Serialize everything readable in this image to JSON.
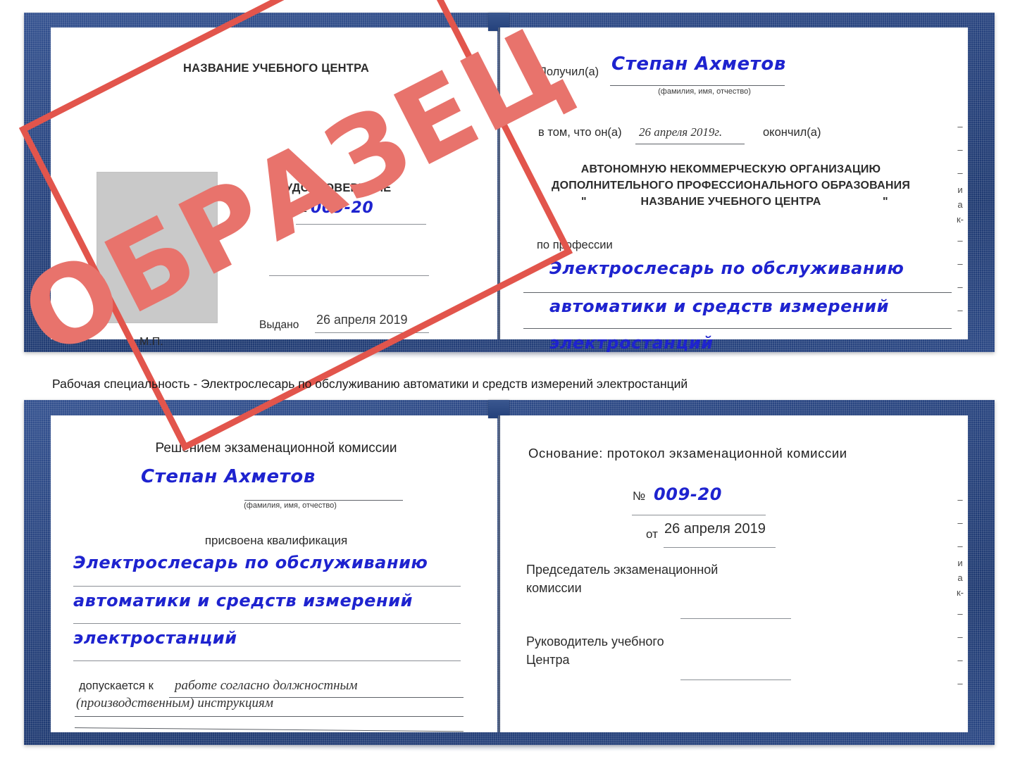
{
  "caption": {
    "text": "Рабочая специальность - Электрослесарь по обслуживанию автоматики и средств измерений электростанций"
  },
  "watermark": {
    "label": "ОБРАЗЕЦ",
    "frame_color": "#e2554c",
    "text_color": "#e8736c"
  },
  "colors": {
    "cover_blue": "#27437e",
    "handwriting_blue": "#1e23cf",
    "page_white": "#ffffff",
    "photo_gray": "#c9c9c9",
    "rule_gray": "#8b8f95"
  },
  "certificate_top": {
    "left_page": {
      "org_title": "НАЗВАНИЕ УЧЕБНОГО ЦЕНТРА",
      "doc_title": "УДОСТОВЕРЕНИЕ",
      "number_label": "№",
      "number_value": "009-20",
      "issued_label": "Выдано",
      "issued_value": "26 апреля 2019",
      "stamp_place_label": "М.П."
    },
    "right_page": {
      "received_label": "Получил(а)",
      "received_value": "Степан Ахметов",
      "fio_hint": "(фамилия, имя, отчество)",
      "in_that_label": "в том, что он(а)",
      "finish_date": "26 апреля 2019г.",
      "finished_label": "окончил(а)",
      "org_line_1": "АВТОНОМНУЮ НЕКОММЕРЧЕСКУЮ ОРГАНИЗАЦИЮ",
      "org_line_2": "ДОПОЛНИТЕЛЬНОГО ПРОФЕССИОНАЛЬНОГО ОБРАЗОВАНИЯ",
      "org_quote_open": "\"",
      "org_line_3": "НАЗВАНИЕ УЧЕБНОГО ЦЕНТРА",
      "org_quote_close": "\"",
      "profession_label": "по профессии",
      "profession_line_1": "Электрослесарь по обслуживанию",
      "profession_line_2": "автоматики и средств измерений",
      "profession_line_3": "электростанций",
      "edge_fragments": [
        "–",
        "–",
        "–",
        "и",
        "а",
        "к-",
        "–",
        "–",
        "–",
        "–"
      ]
    }
  },
  "certificate_bottom": {
    "left_page": {
      "decision_title": "Решением экзаменационной комиссии",
      "name_value": "Степан Ахметов",
      "fio_hint": "(фамилия, имя, отчество)",
      "qualification_label": "присвоена квалификация",
      "qualification_line_1": "Электрослесарь по обслуживанию",
      "qualification_line_2": "автоматики и средств измерений",
      "qualification_line_3": "электростанций",
      "admitted_label": "допускается к",
      "admitted_value_1": "работе согласно должностным",
      "admitted_value_2": "(производственным) инструкциям"
    },
    "right_page": {
      "basis_label": "Основание: протокол экзаменационной комиссии",
      "protocol_number_label": "№",
      "protocol_number_value": "009-20",
      "protocol_date_label": "от",
      "protocol_date_value": "26 апреля 2019",
      "chairman_line_1": "Председатель экзаменационной",
      "chairman_line_2": "комиссии",
      "head_line_1": "Руководитель учебного",
      "head_line_2": "Центра",
      "edge_fragments": [
        "–",
        "–",
        "–",
        "и",
        "а",
        "к-",
        "–",
        "–",
        "–",
        "–"
      ]
    }
  }
}
